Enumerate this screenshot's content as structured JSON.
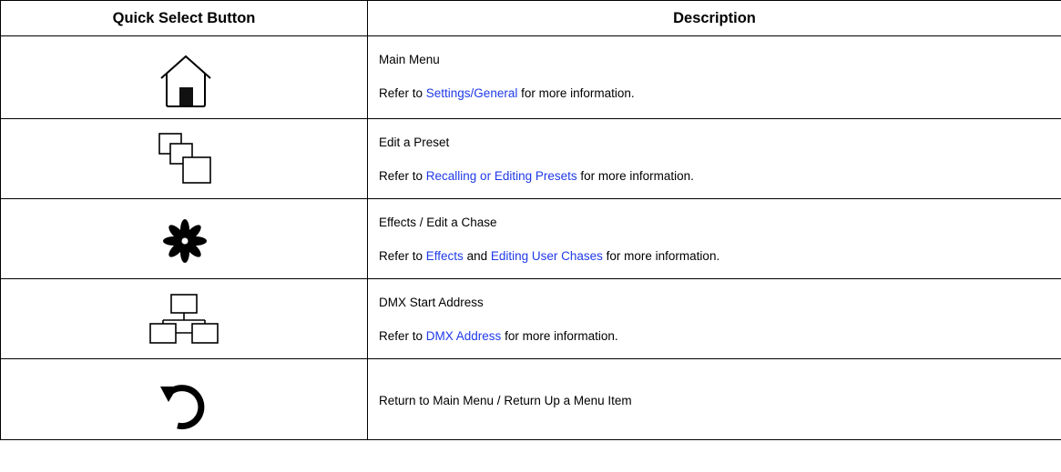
{
  "table": {
    "headers": {
      "col1": "Quick Select Button",
      "col2": "Description"
    },
    "rows": [
      {
        "icon": "home-icon",
        "title": "Main Menu",
        "pre": "Refer to ",
        "link1": "Settings/General",
        "post": " for more information."
      },
      {
        "icon": "edit-preset-icon",
        "title": "Edit a Preset",
        "pre": "Refer to ",
        "link1": "Recalling or Editing Presets",
        "post": " for more information."
      },
      {
        "icon": "effects-asterisk-icon",
        "title": "Effects / Edit a Chase",
        "pre": "Refer to ",
        "link1": "Effects",
        "mid": " and ",
        "link2": "Editing User Chases",
        "post": " for more information."
      },
      {
        "icon": "dmx-network-icon",
        "title": "DMX Start Address",
        "pre": "Refer to ",
        "link1": "DMX Address",
        "post": " for more information."
      },
      {
        "icon": "return-arrow-icon",
        "title": "Return to Main Menu / Return Up a Menu Item"
      }
    ],
    "link_color": "#1f3ae8"
  }
}
